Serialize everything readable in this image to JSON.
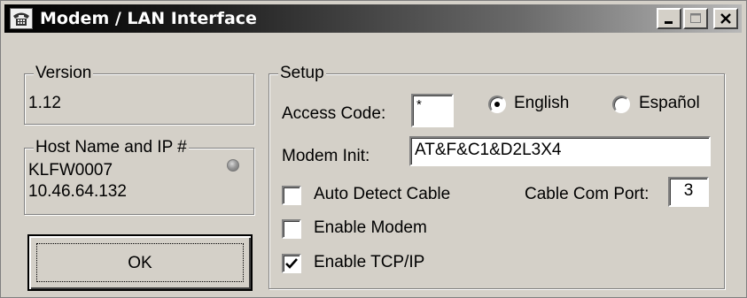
{
  "window": {
    "title": "Modem / LAN Interface",
    "icon": "modem-phone-icon",
    "controls": {
      "minimize": "minimize-icon",
      "maximize": "maximize-icon",
      "close": "close-icon"
    }
  },
  "version_group": {
    "label": "Version",
    "value": "1.12"
  },
  "host_group": {
    "label": "Host Name and IP #",
    "host_name": "KLFW0007",
    "ip_address": "10.46.64.132",
    "status_indicator": "gray"
  },
  "ok_button": {
    "label": "OK"
  },
  "setup_group": {
    "label": "Setup",
    "access_code": {
      "label": "Access Code:",
      "value": "*"
    },
    "language": {
      "options": [
        {
          "label": "English",
          "selected": true
        },
        {
          "label": "Español",
          "selected": false
        }
      ]
    },
    "modem_init": {
      "label": "Modem Init:",
      "value": "AT&F&C1&D2L3X4"
    },
    "auto_detect_cable": {
      "label": "Auto Detect Cable",
      "checked": false
    },
    "cable_com_port": {
      "label": "Cable Com Port:",
      "value": "3"
    },
    "enable_modem": {
      "label": "Enable Modem",
      "checked": false
    },
    "enable_tcpip": {
      "label": "Enable TCP/IP",
      "checked": true
    }
  },
  "colors": {
    "face": "#d4d0c8",
    "title_start": "#000000",
    "title_end": "#b8b8b8"
  }
}
